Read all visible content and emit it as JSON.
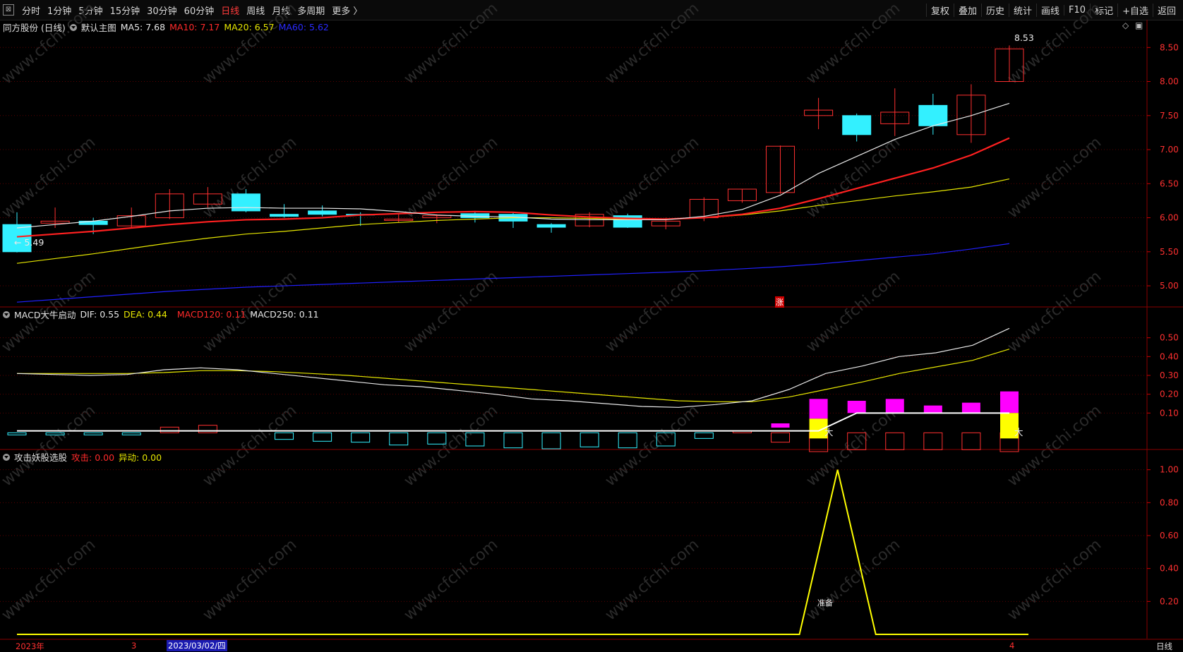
{
  "toolbar": {
    "back_icon": "back-icon",
    "periods": [
      "分时",
      "1分钟",
      "5分钟",
      "15分钟",
      "30分钟",
      "60分钟",
      "日线",
      "周线",
      "月线",
      "多周期",
      "更多 〉"
    ],
    "active_period": "日线",
    "actions": [
      "复权",
      "叠加",
      "历史",
      "统计",
      "画线",
      "F10",
      "标记",
      "+自选",
      "返回"
    ]
  },
  "main_panel": {
    "stock": "同方股份 (日线)",
    "chart_name": "默认主图",
    "ma5": "MA5: 7.68",
    "ma10": "MA10: 7.17",
    "ma20": "MA20: 6.57",
    "ma60": "MA60: 5.62",
    "high_label": "8.53",
    "low_label": "← 5.49",
    "zhang_marker": "涨",
    "y_ticks": [
      "8.50",
      "8.00",
      "7.50",
      "7.00",
      "6.50",
      "6.00",
      "5.50",
      "5.00"
    ]
  },
  "macd_panel": {
    "name": "MACD大牛启动",
    "dif": "DIF: 0.55",
    "dea": "DEA: 0.44",
    "macd120": "MACD120: 0.11",
    "macd250": "MACD250: 0.11",
    "da_label": "大",
    "y_ticks": [
      "0.50",
      "0.40",
      "0.30",
      "0.20",
      "0.10"
    ]
  },
  "signal_panel": {
    "name": "攻击妖股选股",
    "attack": "攻击: 0.00",
    "abnormal": "异动: 0.00",
    "ready_label": "准备",
    "y_ticks": [
      "1.00",
      "0.80",
      "0.60",
      "0.40",
      "0.20"
    ]
  },
  "date_axis": {
    "year_label": "2023年",
    "month_3": "3",
    "cursor_date": "2023/03/02/四",
    "month_4": "4",
    "period_label": "日线"
  },
  "watermark": "www.cfchi.com",
  "chart_data": [
    {
      "type": "candlestick",
      "ylim": [
        4.7,
        8.7
      ],
      "candles": [
        {
          "o": 5.9,
          "h": 6.08,
          "l": 5.49,
          "c": 5.5
        },
        {
          "o": 5.92,
          "h": 6.15,
          "l": 5.85,
          "c": 5.95
        },
        {
          "o": 5.95,
          "h": 6.0,
          "l": 5.76,
          "c": 5.9
        },
        {
          "o": 5.88,
          "h": 6.15,
          "l": 5.85,
          "c": 6.03
        },
        {
          "o": 6.0,
          "h": 6.42,
          "l": 5.98,
          "c": 6.35
        },
        {
          "o": 6.2,
          "h": 6.45,
          "l": 6.15,
          "c": 6.35
        },
        {
          "o": 6.35,
          "h": 6.42,
          "l": 6.08,
          "c": 6.1
        },
        {
          "o": 6.05,
          "h": 6.2,
          "l": 6.0,
          "c": 6.02
        },
        {
          "o": 6.1,
          "h": 6.18,
          "l": 6.02,
          "c": 6.05
        },
        {
          "o": 6.05,
          "h": 6.08,
          "l": 5.88,
          "c": 6.04
        },
        {
          "o": 5.96,
          "h": 6.06,
          "l": 5.93,
          "c": 5.98
        },
        {
          "o": 6.0,
          "h": 6.05,
          "l": 5.92,
          "c": 6.03
        },
        {
          "o": 6.06,
          "h": 6.1,
          "l": 5.93,
          "c": 6.0
        },
        {
          "o": 6.05,
          "h": 6.07,
          "l": 5.85,
          "c": 5.95
        },
        {
          "o": 5.9,
          "h": 5.92,
          "l": 5.78,
          "c": 5.86
        },
        {
          "o": 5.88,
          "h": 6.08,
          "l": 5.86,
          "c": 6.05
        },
        {
          "o": 6.03,
          "h": 6.06,
          "l": 5.85,
          "c": 5.86
        },
        {
          "o": 5.88,
          "h": 6.0,
          "l": 5.83,
          "c": 5.95
        },
        {
          "o": 6.0,
          "h": 6.3,
          "l": 5.95,
          "c": 6.27
        },
        {
          "o": 6.25,
          "h": 6.42,
          "l": 6.22,
          "c": 6.42
        },
        {
          "o": 6.37,
          "h": 7.06,
          "l": 6.35,
          "c": 7.05
        },
        {
          "o": 7.5,
          "h": 7.76,
          "l": 7.3,
          "c": 7.58
        },
        {
          "o": 7.5,
          "h": 7.53,
          "l": 7.12,
          "c": 7.22
        },
        {
          "o": 7.38,
          "h": 7.9,
          "l": 7.2,
          "c": 7.55
        },
        {
          "o": 7.65,
          "h": 7.82,
          "l": 7.22,
          "c": 7.35
        },
        {
          "o": 7.22,
          "h": 7.96,
          "l": 7.1,
          "c": 7.8
        },
        {
          "o": 8.0,
          "h": 8.53,
          "l": 8.0,
          "c": 8.48
        }
      ],
      "ma5": [
        5.85,
        5.9,
        5.95,
        6.02,
        6.1,
        6.14,
        6.15,
        6.14,
        6.14,
        6.13,
        6.09,
        6.04,
        6.02,
        6.01,
        5.98,
        5.97,
        5.97,
        5.97,
        6.02,
        6.12,
        6.33,
        6.65,
        6.9,
        7.15,
        7.35,
        7.5,
        7.68
      ],
      "ma10": [
        5.72,
        5.76,
        5.8,
        5.85,
        5.9,
        5.94,
        5.97,
        5.98,
        6.0,
        6.04,
        6.06,
        6.08,
        6.09,
        6.08,
        6.04,
        6.01,
        5.99,
        5.98,
        6.0,
        6.05,
        6.14,
        6.28,
        6.43,
        6.58,
        6.73,
        6.92,
        7.17
      ],
      "ma20": [
        5.33,
        5.4,
        5.47,
        5.55,
        5.63,
        5.7,
        5.76,
        5.8,
        5.85,
        5.9,
        5.93,
        5.96,
        5.98,
        6.0,
        6.0,
        5.99,
        5.98,
        5.98,
        6.0,
        6.04,
        6.1,
        6.18,
        6.25,
        6.32,
        6.38,
        6.45,
        6.57
      ],
      "ma60": [
        4.76,
        4.8,
        4.84,
        4.88,
        4.92,
        4.95,
        4.98,
        5.0,
        5.02,
        5.04,
        5.06,
        5.08,
        5.1,
        5.12,
        5.14,
        5.16,
        5.18,
        5.2,
        5.22,
        5.25,
        5.28,
        5.32,
        5.37,
        5.42,
        5.47,
        5.54,
        5.62
      ]
    },
    {
      "type": "bar",
      "ylim": [
        -0.09,
        0.6
      ],
      "dif": [
        0.31,
        0.305,
        0.3,
        0.305,
        0.33,
        0.34,
        0.33,
        0.31,
        0.29,
        0.27,
        0.25,
        0.24,
        0.22,
        0.2,
        0.175,
        0.165,
        0.15,
        0.135,
        0.13,
        0.145,
        0.165,
        0.225,
        0.31,
        0.35,
        0.4,
        0.42,
        0.46,
        0.55
      ],
      "dea": [
        0.31,
        0.31,
        0.31,
        0.31,
        0.315,
        0.325,
        0.325,
        0.32,
        0.31,
        0.3,
        0.285,
        0.27,
        0.255,
        0.24,
        0.225,
        0.21,
        0.195,
        0.18,
        0.165,
        0.16,
        0.16,
        0.185,
        0.225,
        0.265,
        0.31,
        0.345,
        0.38,
        0.44
      ],
      "macd_line": [
        0.0,
        0.0,
        0.0,
        0.0,
        0.0,
        0.0,
        0.0,
        0.0,
        0.0,
        0.0,
        0.0,
        0.0,
        0.0,
        0.0,
        0.0,
        0.0,
        0.0,
        0.0,
        0.0,
        0.0,
        0.0,
        0.0,
        0.1,
        0.1,
        0.1,
        0.1,
        0.1,
        0.11
      ],
      "hist": [
        0.0,
        -0.01,
        -0.015,
        -0.01,
        0.03,
        0.04,
        0.0,
        -0.035,
        -0.045,
        -0.05,
        -0.065,
        -0.06,
        -0.07,
        -0.08,
        -0.085,
        -0.075,
        -0.08,
        -0.07,
        -0.03,
        0.01,
        -0.05,
        -0.1,
        -0.09,
        -0.09,
        -0.09,
        -0.09,
        -0.1
      ],
      "bars": [
        -0.01,
        -0.01,
        -0.01,
        -0.01,
        0.03,
        0.04,
        0.0,
        -0.035,
        -0.045,
        -0.05,
        -0.065,
        -0.06,
        -0.07,
        -0.08,
        -0.085,
        -0.075,
        -0.08,
        -0.07,
        -0.03,
        0.01,
        -0.05,
        -0.1,
        -0.09,
        -0.09,
        -0.09,
        -0.09,
        -0.1
      ],
      "magenta_top": [
        null,
        null,
        null,
        null,
        null,
        null,
        null,
        null,
        null,
        null,
        null,
        null,
        null,
        null,
        null,
        null,
        null,
        null,
        null,
        null,
        0.045,
        0.175,
        0.165,
        0.175,
        0.14,
        0.155,
        0.215
      ],
      "yellow_days": [
        21,
        26
      ]
    },
    {
      "type": "line",
      "ylim": [
        0,
        1.05
      ],
      "x": [
        0,
        20.5,
        21.5,
        22.5,
        26.5
      ],
      "attack": [
        0,
        0,
        1.0,
        0,
        0
      ]
    }
  ]
}
